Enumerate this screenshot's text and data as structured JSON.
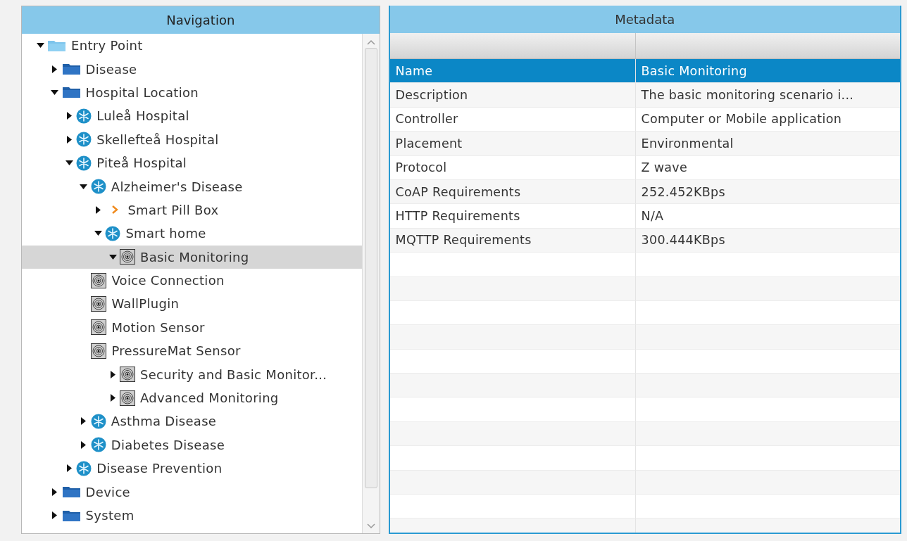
{
  "navigation": {
    "title": "Navigation",
    "tree": [
      {
        "label": "Entry Point",
        "kind": "light-folder",
        "expanded": true,
        "selected": false,
        "children": [
          {
            "label": "Disease",
            "kind": "folder",
            "expanded": false,
            "selected": false
          },
          {
            "label": "Hospital Location",
            "kind": "folder",
            "expanded": true,
            "selected": false,
            "children": [
              {
                "label": "Luleå Hospital",
                "kind": "node",
                "expanded": false,
                "selected": false
              },
              {
                "label": "Skellefteå Hospital",
                "kind": "node",
                "expanded": false,
                "selected": false
              },
              {
                "label": "Piteå Hospital",
                "kind": "node",
                "expanded": true,
                "selected": false,
                "children": [
                  {
                    "label": "Alzheimer's Disease",
                    "kind": "node",
                    "expanded": true,
                    "selected": false,
                    "children": [
                      {
                        "label": "Smart Pill Box",
                        "kind": "chevron",
                        "expanded": false,
                        "selected": false
                      },
                      {
                        "label": "Smart home",
                        "kind": "node",
                        "expanded": true,
                        "selected": false,
                        "children": [
                          {
                            "label": "Basic Monitoring",
                            "kind": "sensor",
                            "expanded": true,
                            "selected": true,
                            "children": [
                              {
                                "label": "Voice Connection",
                                "kind": "sensor",
                                "selected": false
                              },
                              {
                                "label": "WallPlugin",
                                "kind": "sensor",
                                "selected": false
                              },
                              {
                                "label": "Motion Sensor",
                                "kind": "sensor",
                                "selected": false
                              },
                              {
                                "label": "PressureMat Sensor",
                                "kind": "sensor",
                                "selected": false
                              }
                            ]
                          },
                          {
                            "label": "Security and Basic Monitor...",
                            "kind": "sensor",
                            "expanded": false,
                            "selected": false
                          },
                          {
                            "label": "Advanced Monitoring",
                            "kind": "sensor",
                            "expanded": false,
                            "selected": false
                          }
                        ]
                      }
                    ]
                  },
                  {
                    "label": "Asthma Disease",
                    "kind": "node",
                    "expanded": false,
                    "selected": false
                  },
                  {
                    "label": "Diabetes Disease",
                    "kind": "node",
                    "expanded": false,
                    "selected": false
                  }
                ]
              },
              {
                "label": "Disease Prevention",
                "kind": "node",
                "expanded": false,
                "selected": false
              }
            ]
          },
          {
            "label": "Device",
            "kind": "folder",
            "expanded": false,
            "selected": false
          },
          {
            "label": "System",
            "kind": "folder",
            "expanded": false,
            "selected": false
          }
        ]
      }
    ]
  },
  "metadata": {
    "title": "Metadata",
    "rows": [
      {
        "key": "Name",
        "value": "Basic Monitoring",
        "selected": true
      },
      {
        "key": "Description",
        "value": "The basic monitoring scenario i...",
        "selected": false
      },
      {
        "key": "Controller",
        "value": "Computer or Mobile application",
        "selected": false
      },
      {
        "key": "Placement",
        "value": "Environmental",
        "selected": false
      },
      {
        "key": "Protocol",
        "value": "Z wave",
        "selected": false
      },
      {
        "key": "CoAP Requirements",
        "value": "252.452KBps",
        "selected": false
      },
      {
        "key": "HTTP Requirements",
        "value": "N/A",
        "selected": false
      },
      {
        "key": "MQTTP Requirements",
        "value": "300.444KBps",
        "selected": false
      }
    ]
  }
}
